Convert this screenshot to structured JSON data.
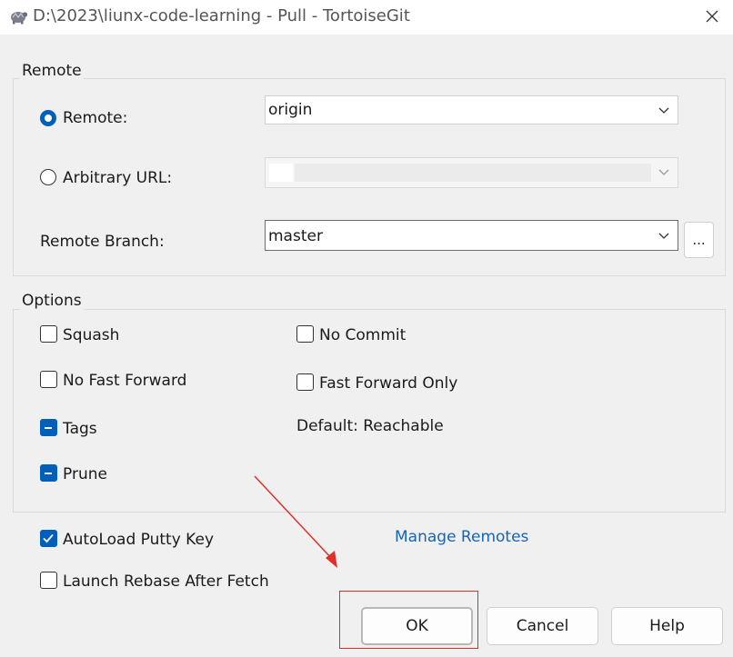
{
  "window": {
    "title": "D:\\2023\\liunx-code-learning - Pull - TortoiseGit",
    "icon": "tortoise-icon"
  },
  "remote_group": {
    "title": "Remote",
    "remote_radio_label": "Remote:",
    "remote_selected": true,
    "remote_value": "origin",
    "url_radio_label": "Arbitrary URL:",
    "url_value": "",
    "branch_label": "Remote Branch:",
    "branch_value": "master",
    "browse_label": "..."
  },
  "options_group": {
    "title": "Options",
    "squash": {
      "label": "Squash",
      "state": "unchecked"
    },
    "no_fast_forward": {
      "label": "No Fast Forward",
      "state": "unchecked"
    },
    "tags": {
      "label": "Tags",
      "state": "indeterminate"
    },
    "prune": {
      "label": "Prune",
      "state": "indeterminate"
    },
    "no_commit": {
      "label": "No Commit",
      "state": "unchecked"
    },
    "fast_forward_only": {
      "label": "Fast Forward Only",
      "state": "unchecked"
    },
    "default_text": "Default: Reachable"
  },
  "bottom": {
    "autoload_putty": {
      "label": "AutoLoad Putty Key",
      "state": "checked"
    },
    "launch_rebase": {
      "label": "Launch Rebase After Fetch",
      "state": "unchecked"
    },
    "manage_remotes": "Manage Remotes"
  },
  "buttons": {
    "ok": "OK",
    "cancel": "Cancel",
    "help": "Help"
  },
  "colors": {
    "accent": "#005fb8",
    "link": "#1764b5",
    "annotation": "#e0302a"
  }
}
